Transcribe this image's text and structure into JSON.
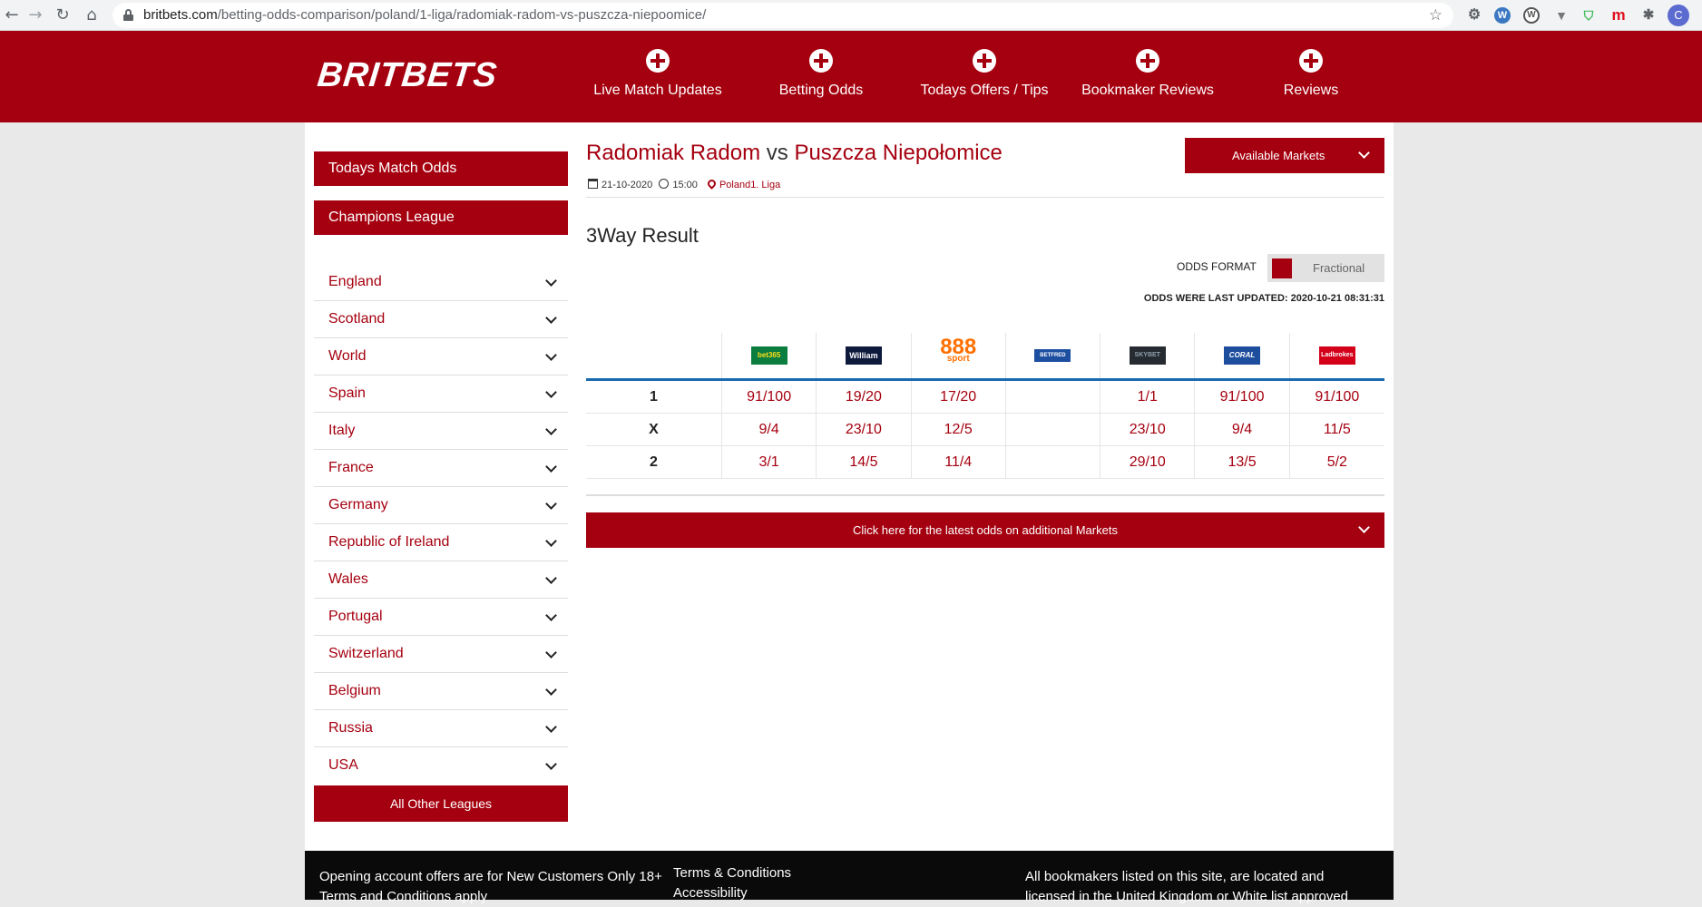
{
  "browser": {
    "url_domain": "britbets.com",
    "url_path": "/betting-odds-comparison/poland/1-liga/radomiak-radom-vs-puszcza-niepoomice/",
    "profile_initial": "C",
    "extensions": [
      "gear-icon",
      "wordpress-icon",
      "wordpress-icon",
      "vuejs-icon",
      "cart-icon",
      "m-icon",
      "puzzle-icon"
    ]
  },
  "site": {
    "logo": "BRITBETS",
    "nav": [
      {
        "label": "Live Match Updates"
      },
      {
        "label": "Betting Odds"
      },
      {
        "label": "Todays Offers / Tips"
      },
      {
        "label": "Bookmaker Reviews"
      },
      {
        "label": "Reviews"
      }
    ]
  },
  "sidebar": {
    "todays_match_odds": "Todays Match Odds",
    "champions_league": "Champions League",
    "leagues": [
      "England",
      "Scotland",
      "World",
      "Spain",
      "Italy",
      "France",
      "Germany",
      "Republic of Ireland",
      "Wales",
      "Portugal",
      "Switzerland",
      "Belgium",
      "Russia",
      "USA"
    ],
    "all_other": "All Other Leagues"
  },
  "match": {
    "home": "Radomiak Radom",
    "vs": "vs",
    "away": "Puszcza Niepołomice",
    "date": "21-10-2020",
    "time": "15:00",
    "location": "Poland1. Liga",
    "available_markets": "Available Markets",
    "section_title": "3Way Result",
    "odds_format_label": "ODDS FORMAT",
    "odds_format_value": "Fractional",
    "last_updated": "ODDS WERE LAST UPDATED: 2020-10-21 08:31:31",
    "more_markets": "Click here for the latest odds on additional Markets"
  },
  "bookmakers": [
    {
      "logo_text": "bet365"
    },
    {
      "logo_text": "William HILL"
    },
    {
      "logo_text": "888",
      "sub": "sport"
    },
    {
      "logo_text": "BETFRED"
    },
    {
      "logo_text": "SKYBET"
    },
    {
      "logo_text": "CORAL"
    },
    {
      "logo_text": "Ladbrokes"
    }
  ],
  "odds": [
    {
      "outcome": "1",
      "values": [
        "91/100",
        "19/20",
        "17/20",
        "",
        "1/1",
        "91/100",
        "91/100"
      ]
    },
    {
      "outcome": "X",
      "values": [
        "9/4",
        "23/10",
        "12/5",
        "",
        "23/10",
        "9/4",
        "11/5"
      ]
    },
    {
      "outcome": "2",
      "values": [
        "3/1",
        "14/5",
        "11/4",
        "",
        "29/10",
        "13/5",
        "5/2"
      ]
    }
  ],
  "footer": {
    "col1_line1": "Opening account offers are for New Customers Only 18+",
    "col1_line2": "Terms and Conditions apply",
    "col2_line1": "Terms & Conditions",
    "col2_line2": "Accessibility",
    "col3_line1": "All bookmakers listed on this site, are located and",
    "col3_line2": "licensed in the United Kingdom or White list approved"
  },
  "colors": {
    "brand": "#a5000f",
    "accent_line": "#1a6ab0"
  }
}
